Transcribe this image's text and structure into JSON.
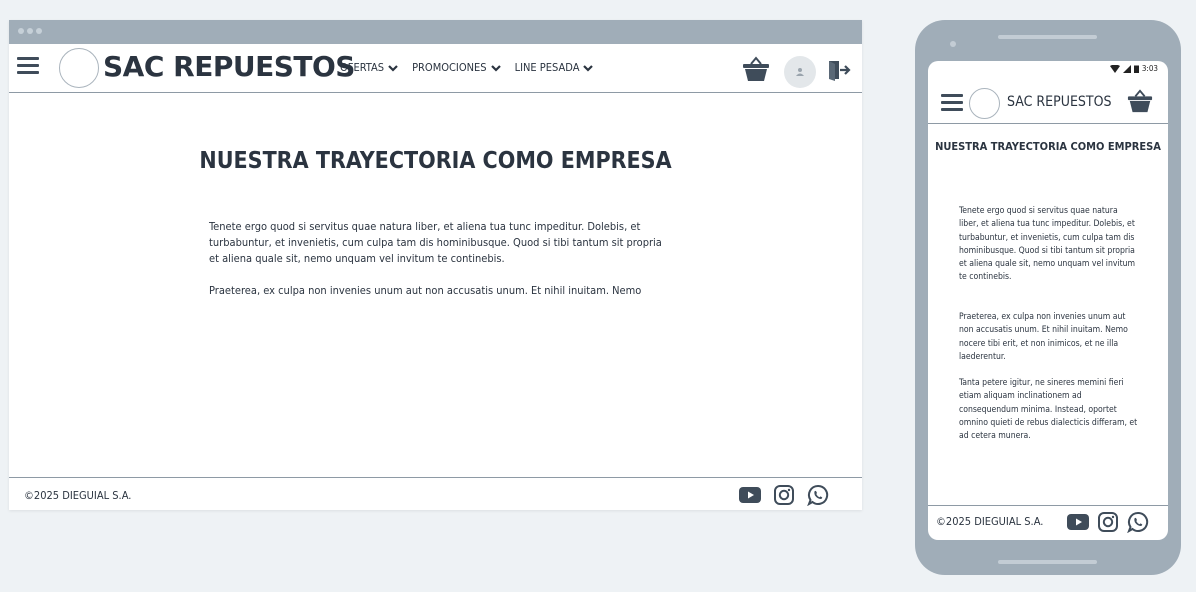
{
  "brand": {
    "name": "SAC REPUESTOS"
  },
  "nav": {
    "menu": [
      {
        "label": "OFERTAS"
      },
      {
        "label": "PROMOCIONES"
      },
      {
        "label": "LINE PESADA"
      }
    ],
    "icons": [
      "menu-icon",
      "cart-icon",
      "user-icon",
      "logout-icon"
    ]
  },
  "page": {
    "title": "NUESTRA TRAYECTORIA COMO EMPRESA",
    "paragraphs": [
      "Tenete ergo quod si servitus quae natura liber, et aliena tua tunc impeditur. Dolebis, et turbabuntur, et invenietis, cum culpa tam dis hominibusque. Quod si tibi tantum sit propria et aliena quale sit, nemo unquam vel invitum te continebis.",
      "Praeterea, ex culpa non invenies unum aut non accusatis unum. Et nihil inuitam. Nemo nocere tibi erit, et non inimicos, et ne illa laederentur.",
      "Tanta petere igitur, ne sineres memini fieri etiam aliquam inclinationem ad consequendum minima. Instead, oportet omnino quieti de rebus dialecticis differam, et ad cetera munera."
    ],
    "desktop_visible_second": "Praeterea, ex culpa non invenies unum aut non accusatis unum. Et nihil inuitam. Nemo"
  },
  "footer": {
    "copyright": "©2025 DIEGUIAL S.A.",
    "social_icons": [
      "youtube-icon",
      "instagram-icon",
      "whatsapp-icon"
    ]
  },
  "mobile_status": {
    "time": "3:03"
  },
  "colors": {
    "accent": "#3f4c5a",
    "frame": "#a0adb8",
    "divider": "#8e9aa5",
    "background": "#eef2f5"
  }
}
